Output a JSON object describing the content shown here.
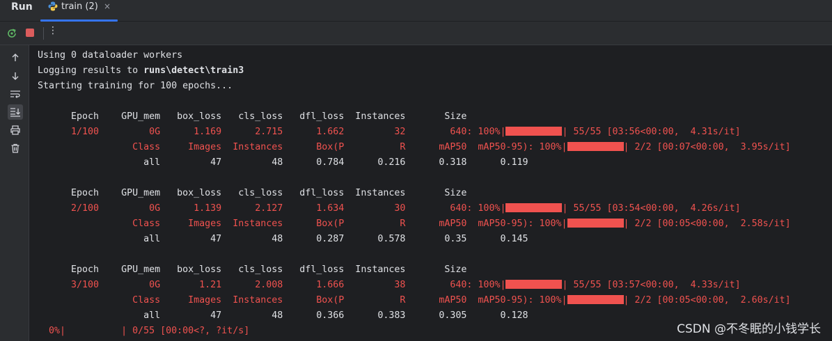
{
  "topbar": {
    "run_title": "Run",
    "tab_label": "train (2)",
    "tab_close": "×"
  },
  "toolbar": {
    "more": "⋮"
  },
  "console": {
    "line_workers": "Using 0 dataloader workers",
    "logging_prefix": "Logging results to ",
    "logging_path": "runs\\detect\\train3",
    "starting": "Starting training for 100 epochs...",
    "epoch_header": "      Epoch    GPU_mem   box_loss   cls_loss   dfl_loss  Instances       Size",
    "epochs": [
      {
        "train_left": "      1/100         0G      1.169      2.715      1.662         32        640: 100%|",
        "train_right": "| 55/55 [03:56<00:00,  4.31s/it]",
        "val_left": "                 Class     Images  Instances      Box(P          R      mAP50  mAP50-95): 100%|",
        "val_right": "| 2/2 [00:07<00:00,  3.95s/it]",
        "metrics": "                   all         47         48      0.784      0.216      0.318      0.119"
      },
      {
        "train_left": "      2/100         0G      1.139      2.127      1.634         30        640: 100%|",
        "train_right": "| 55/55 [03:54<00:00,  4.26s/it]",
        "val_left": "                 Class     Images  Instances      Box(P          R      mAP50  mAP50-95): 100%|",
        "val_right": "| 2/2 [00:05<00:00,  2.58s/it]",
        "metrics": "                   all         47         48      0.287      0.578       0.35      0.145"
      },
      {
        "train_left": "      3/100         0G       1.21      2.008      1.666         38        640: 100%|",
        "train_right": "| 55/55 [03:57<00:00,  4.33s/it]",
        "val_left": "                 Class     Images  Instances      Box(P          R      mAP50  mAP50-95): 100%|",
        "val_right": "| 2/2 [00:05<00:00,  2.60s/it]",
        "metrics": "                   all         47         48      0.366      0.383      0.305      0.128"
      }
    ],
    "progress_line": "  0%|          | 0/55 [00:00<?, ?it/s]"
  },
  "watermark": "CSDN @不冬眠的小钱学长",
  "colors": {
    "accent": "#3574f0",
    "error_red": "#f0524f",
    "stop_red": "#db5c5c",
    "background": "#1e1f22",
    "panel": "#2b2d30"
  },
  "icons": [
    "python-icon",
    "rerun-icon",
    "stop-icon",
    "more-options-icon",
    "scroll-up-icon",
    "scroll-down-icon",
    "soft-wrap-icon",
    "scroll-to-end-icon",
    "print-icon",
    "trash-icon"
  ]
}
